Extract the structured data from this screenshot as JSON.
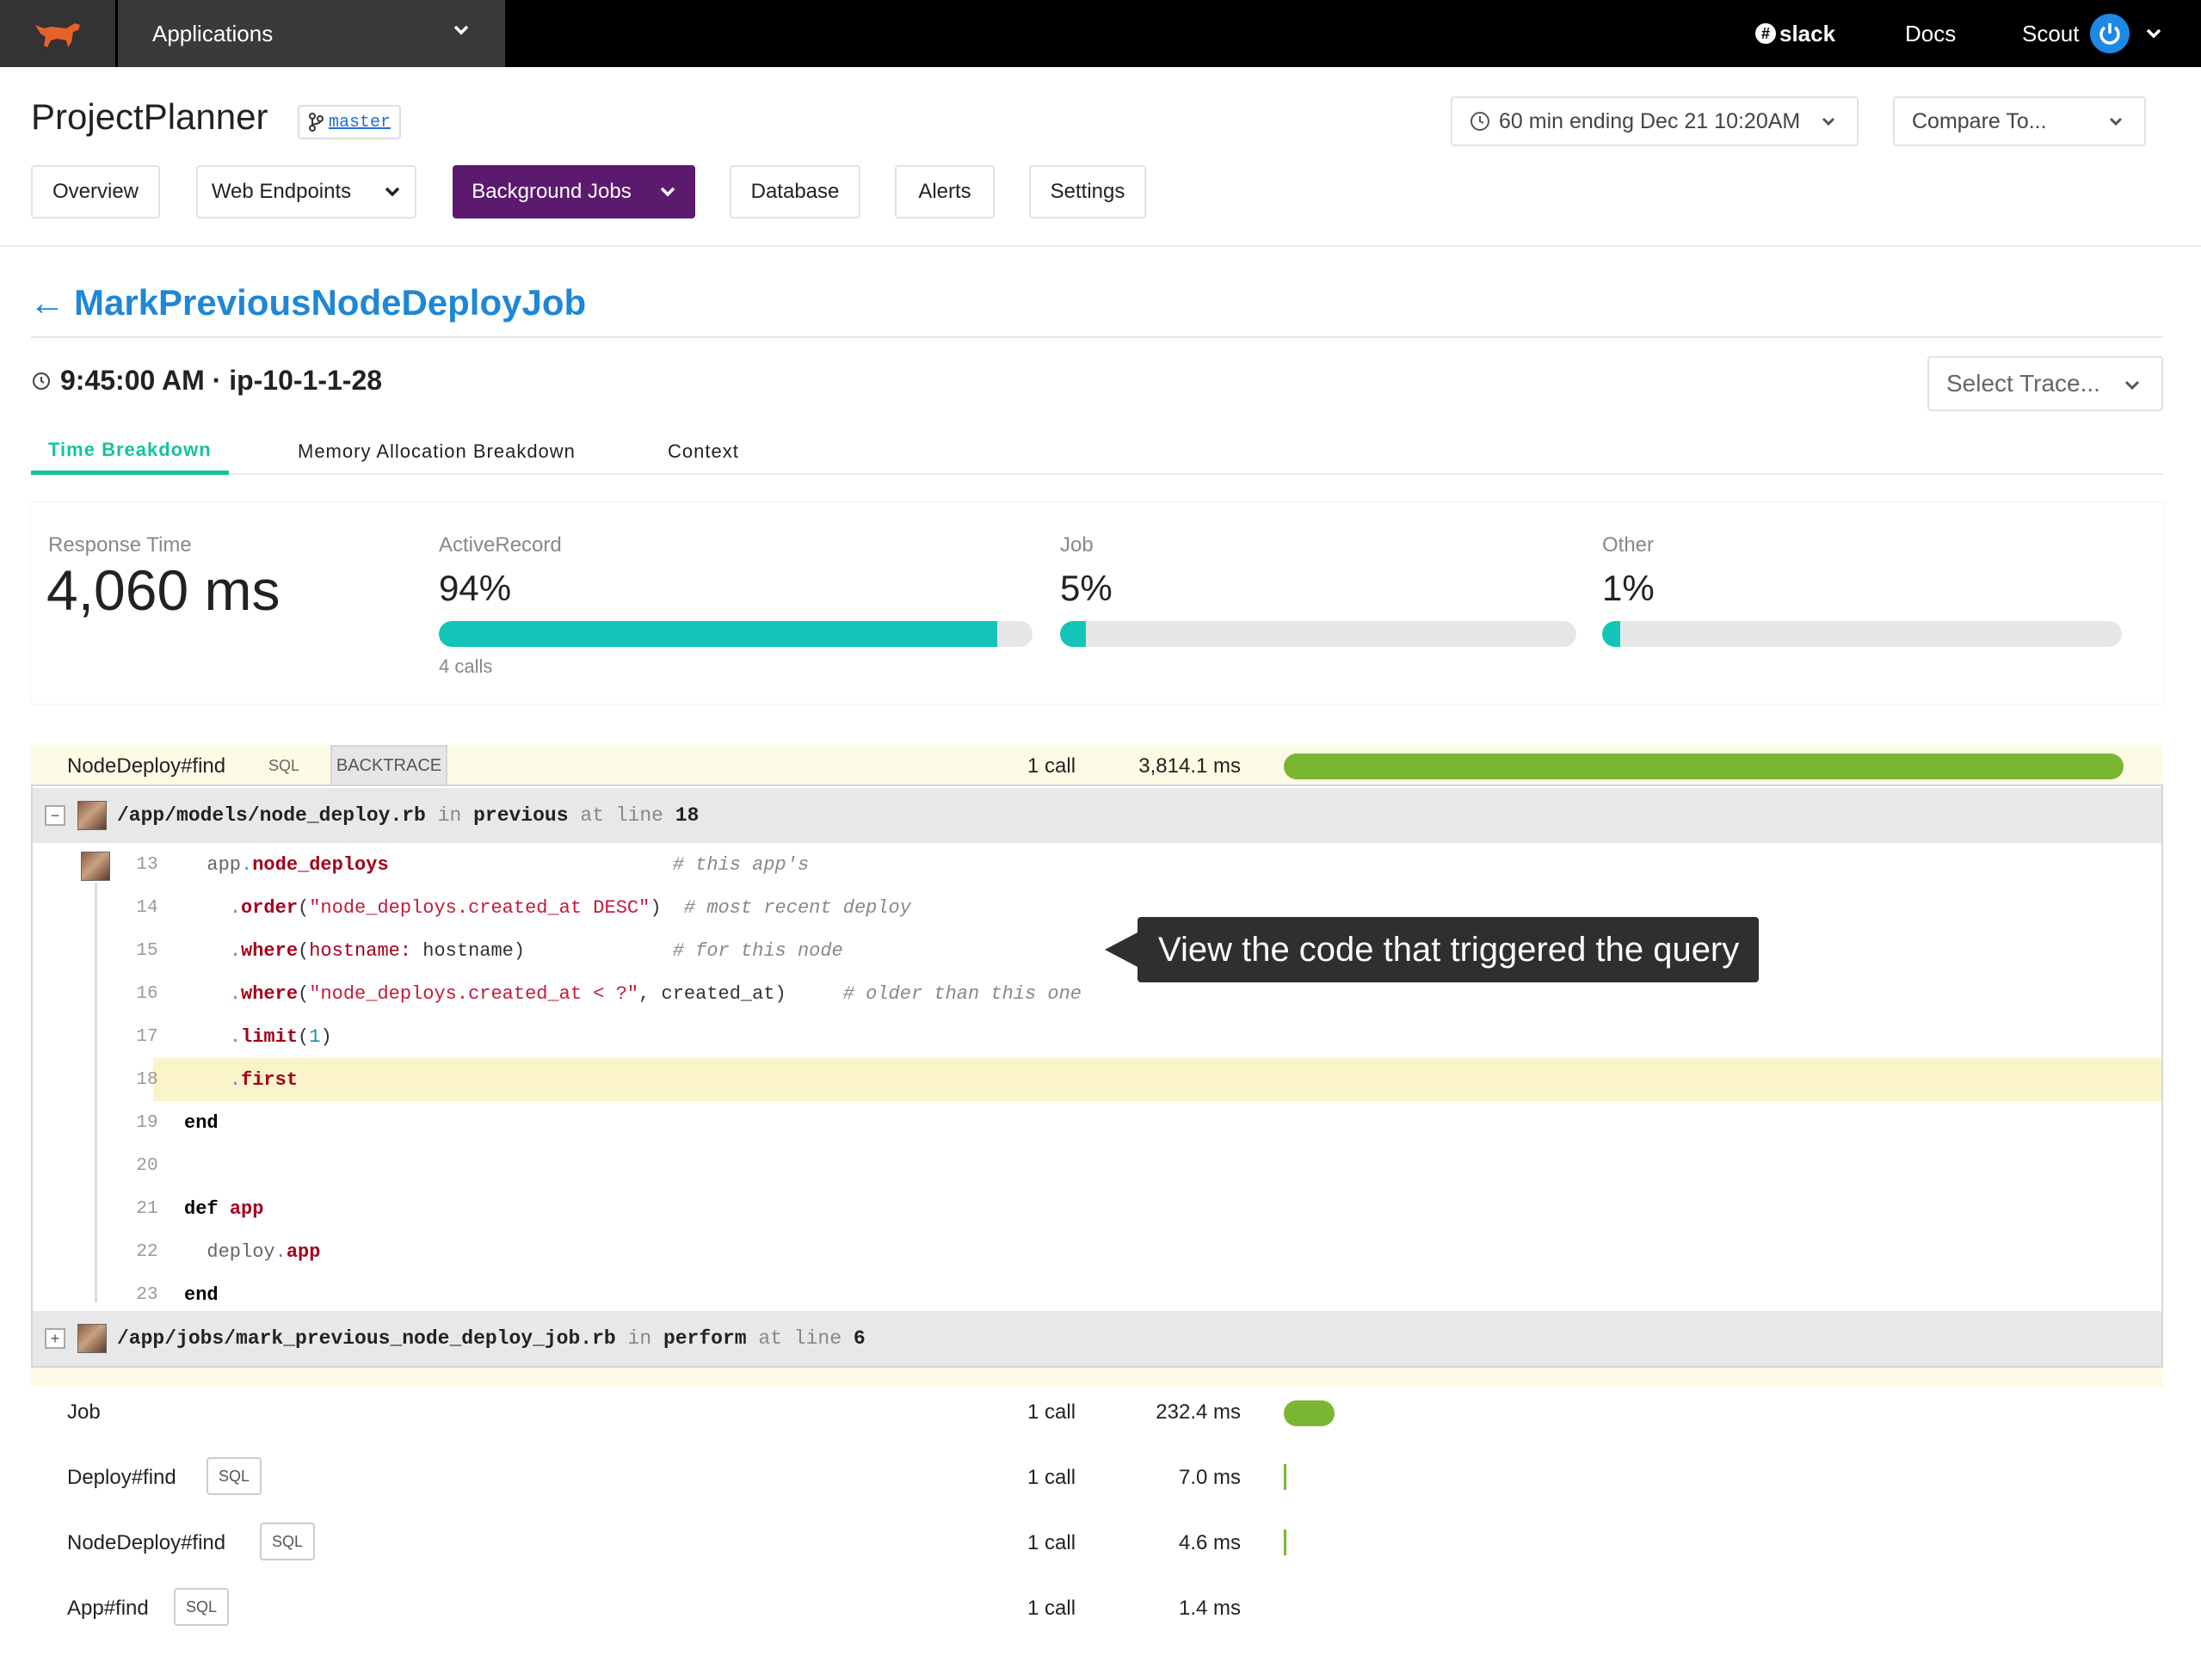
{
  "topbar": {
    "apps_label": "Applications",
    "slack_label": "slack",
    "docs_label": "Docs",
    "user_label": "Scout"
  },
  "header": {
    "project": "ProjectPlanner",
    "branch": "master",
    "time_range": "60 min ending Dec 21 10:20AM",
    "compare": "Compare To..."
  },
  "nav": [
    {
      "label": "Overview"
    },
    {
      "label": "Web Endpoints"
    },
    {
      "label": "Background Jobs"
    },
    {
      "label": "Database"
    },
    {
      "label": "Alerts"
    },
    {
      "label": "Settings"
    }
  ],
  "job": {
    "back_arrow": "←",
    "title": "MarkPreviousNodeDeployJob",
    "trace_time": "9:45:00 AM · ip-10-1-1-28",
    "select_trace": "Select Trace..."
  },
  "tabs": [
    {
      "label": "Time Breakdown",
      "active": true
    },
    {
      "label": "Memory Allocation Breakdown",
      "active": false
    },
    {
      "label": "Context",
      "active": false
    }
  ],
  "summary": {
    "response_label": "Response Time",
    "response_value": "4,060 ms",
    "metrics": [
      {
        "label": "ActiveRecord",
        "value": "94%",
        "fraction": 0.94,
        "sub": "4 calls"
      },
      {
        "label": "Job",
        "value": "5%",
        "fraction": 0.05,
        "sub": ""
      },
      {
        "label": "Other",
        "value": "1%",
        "fraction": 0.01,
        "sub": ""
      }
    ]
  },
  "trace_rows": [
    {
      "name": "NodeDeploy#find",
      "tag": "SQL",
      "backtrace": "BACKTRACE",
      "calls": "1 call",
      "ms": "3,814.1 ms",
      "ms_value": 3814.1
    },
    {
      "name": "Job",
      "tag": "",
      "calls": "1 call",
      "ms": "232.4 ms",
      "ms_value": 232.4
    },
    {
      "name": "Deploy#find",
      "tag": "SQL",
      "calls": "1 call",
      "ms": "7.0 ms",
      "ms_value": 7.0
    },
    {
      "name": "NodeDeploy#find",
      "tag": "SQL",
      "calls": "1 call",
      "ms": "4.6 ms",
      "ms_value": 4.6
    },
    {
      "name": "App#find",
      "tag": "SQL",
      "calls": "1 call",
      "ms": "1.4 ms",
      "ms_value": 1.4
    }
  ],
  "backtrace": {
    "frame1": {
      "toggle": "−",
      "path": "/app/models/node_deploy.rb",
      "in": "in",
      "method": "previous",
      "at": "at",
      "line_word": "line",
      "line": "18"
    },
    "frame2": {
      "toggle": "+",
      "path": "/app/jobs/mark_previous_node_deploy_job.rb",
      "in": "in",
      "method": "perform",
      "at": "at",
      "line_word": "line",
      "line": "6"
    },
    "line_numbers": [
      "13",
      "14",
      "15",
      "16",
      "17",
      "18",
      "19",
      "20",
      "21",
      "22",
      "23"
    ]
  },
  "callout": "View the code that triggered the query",
  "colors": {
    "accent_nav": "#5c1a6e",
    "tab_active": "#15c39a",
    "summary_bar": "#13c4b8",
    "timeline_bar": "#7ab631",
    "link": "#1e87d6"
  }
}
